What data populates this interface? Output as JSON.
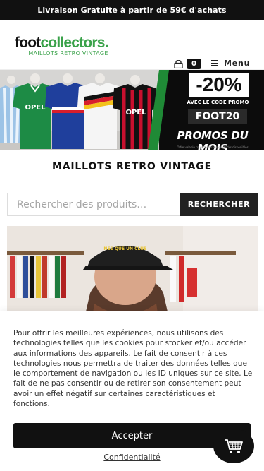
{
  "topbar": {
    "text": "Livraison Gratuite à partir de 59€ d'achats"
  },
  "header": {
    "logo_main_a": "foot",
    "logo_main_b": "collectors.",
    "logo_sub": "MAILLOTS RETRO VINTAGE",
    "cart_count": "0",
    "menu_label": "Menu"
  },
  "banner": {
    "discount": "-20%",
    "code_label": "AVEC LE CODE PROMO",
    "code": "FOOT20",
    "headline": "PROMOS DU MOIS",
    "small_print": "Offre valable toute la durée des stocks disponibles",
    "jersey_sponsor_1": "OPEL",
    "jersey_sponsor_2": "OPEL"
  },
  "section": {
    "title": "MAILLOTS RETRO VINTAGE"
  },
  "search": {
    "placeholder": "Rechercher des produits…",
    "button_label": "RECHERCHER"
  },
  "photo": {
    "cap_text": "NÉS QUE UN CLUB"
  },
  "consent": {
    "text": "Pour offrir les meilleures expériences, nous utilisons des technologies telles que les cookies pour stocker et/ou accéder aux informations des appareils. Le fait de consentir à ces technologies nous permettra de traiter des données telles que le comportement de navigation ou les ID uniques sur ce site. Le fait de ne pas consentir ou de retirer son consentement peut avoir un effet négatif sur certaines caractéristiques et fonctions.",
    "accept_label": "Accepter",
    "privacy_label": "Confidentialité"
  },
  "colors": {
    "brand_green": "#3aa24a",
    "dark": "#111111"
  }
}
